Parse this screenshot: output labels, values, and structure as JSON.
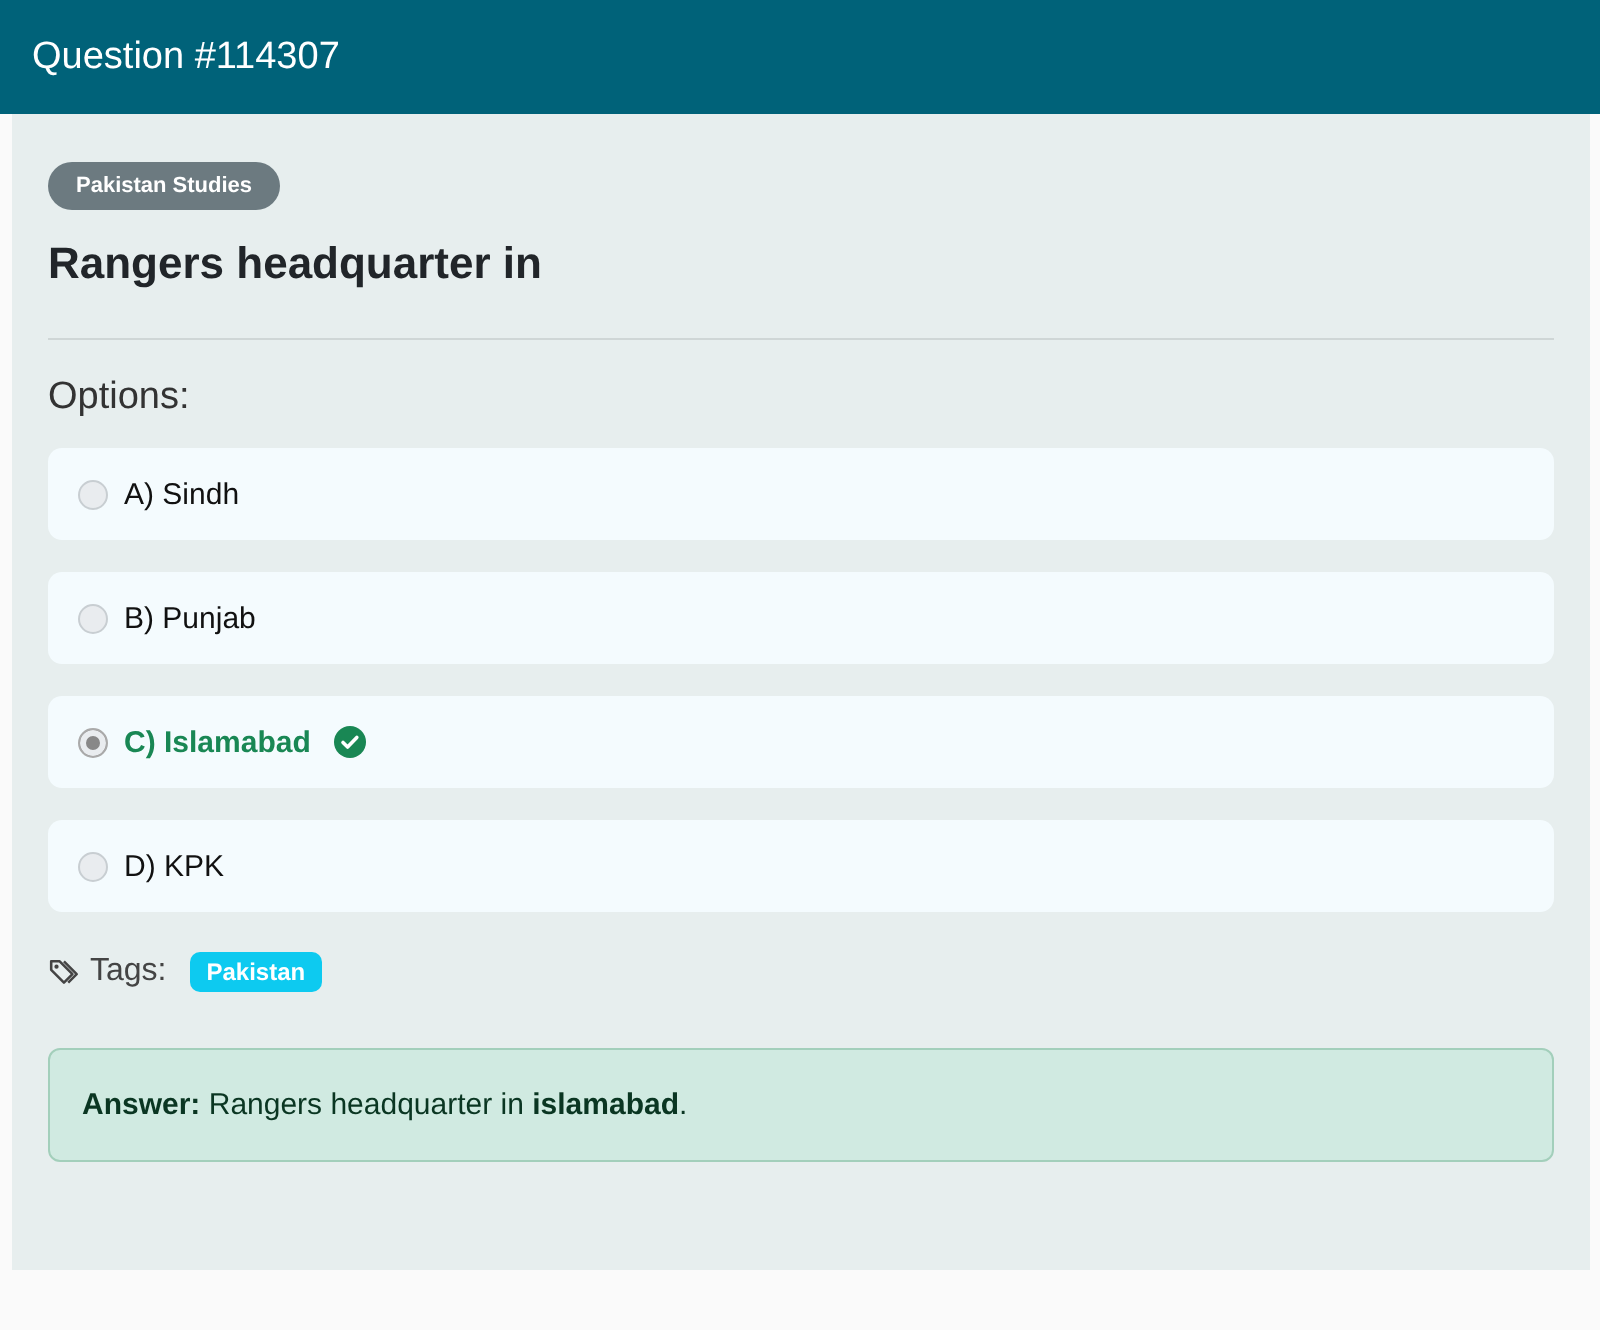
{
  "header": {
    "title": "Question #114307"
  },
  "category": "Pakistan Studies",
  "question": "Rangers headquarter in",
  "options_label": "Options:",
  "options": [
    {
      "label": "A) Sindh",
      "selected": false,
      "correct": false
    },
    {
      "label": "B) Punjab",
      "selected": false,
      "correct": false
    },
    {
      "label": "C) Islamabad",
      "selected": true,
      "correct": true
    },
    {
      "label": "D) KPK",
      "selected": false,
      "correct": false
    }
  ],
  "tags_label": "Tags:",
  "tags": [
    "Pakistan"
  ],
  "answer": "**Answer:** Rangers headquarter in **islamabad**."
}
